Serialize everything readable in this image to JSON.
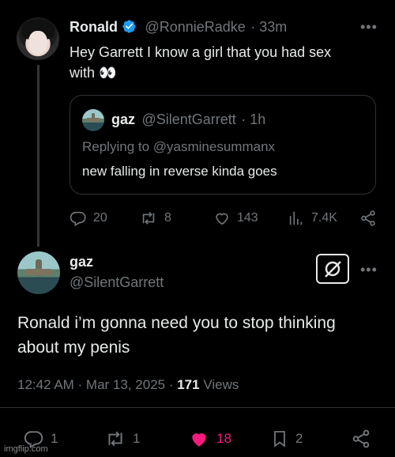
{
  "parent_tweet": {
    "name": "Ronald",
    "handle": "@RonnieRadke",
    "time": "· 33m",
    "text_line1": "Hey Garrett I know a girl that you had sex",
    "text_line2": "with 👀",
    "quote": {
      "name": "gaz",
      "handle": "@SilentGarrett",
      "time": "· 1h",
      "replying_to": "Replying to @yasminesummanx",
      "text": "new falling in reverse kinda goes"
    },
    "stats": {
      "replies": "20",
      "retweets": "8",
      "likes": "143",
      "views": "7.4K"
    }
  },
  "reply_tweet": {
    "name": "gaz",
    "handle": "@SilentGarrett",
    "text_line1": "Ronald i’m gonna need you to stop thinking",
    "text_line2": "about my penis",
    "timestamp": "12:42 AM · Mar 13, 2025 · ",
    "views_count": "171",
    "views_label": " Views",
    "stats": {
      "replies": "1",
      "retweets": "1",
      "likes": "18",
      "bookmarks": "2"
    }
  },
  "colors": {
    "verified": "#1d9bf0",
    "like_active": "#f91880",
    "muted": "#71767b"
  },
  "watermark": "imgflip.com"
}
